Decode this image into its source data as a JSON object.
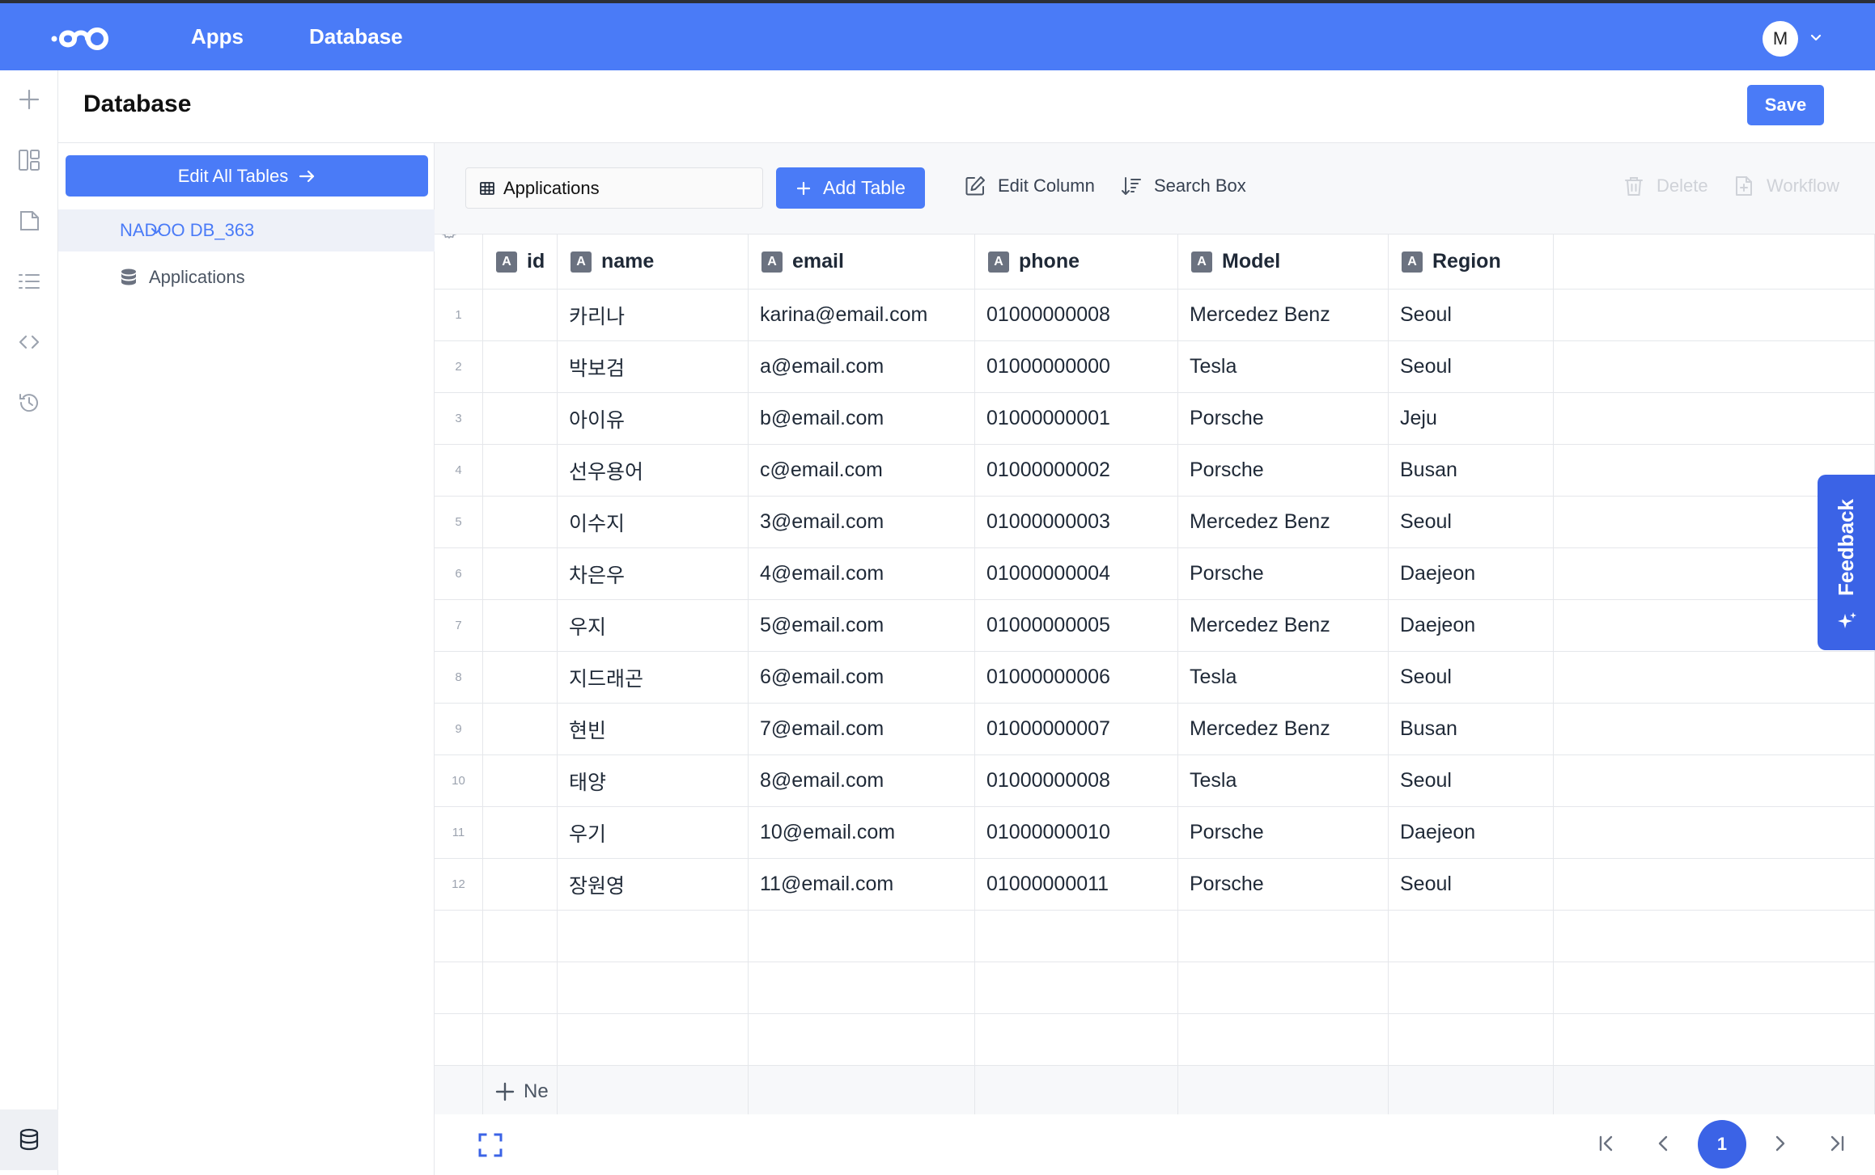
{
  "topbar": {
    "nav": [
      "Apps",
      "Database"
    ],
    "avatar_initial": "M"
  },
  "page": {
    "title": "Database",
    "save_label": "Save"
  },
  "sidebar": {
    "edit_all_label": "Edit All Tables",
    "database_name": "NADOO DB_363",
    "tables": [
      "Applications"
    ]
  },
  "toolbar": {
    "selected_table": "Applications",
    "add_table_label": "Add Table",
    "edit_column_label": "Edit Column",
    "search_box_label": "Search Box",
    "delete_label": "Delete",
    "workflow_label": "Workflow"
  },
  "table": {
    "columns": [
      "id",
      "name",
      "email",
      "phone",
      "Model",
      "Region"
    ],
    "rows": [
      [
        "1",
        "",
        "카리나",
        "karina@email.com",
        "01000000008",
        "Mercedez Benz",
        "Seoul"
      ],
      [
        "2",
        "",
        "박보검",
        "a@email.com",
        "01000000000",
        "Tesla",
        "Seoul"
      ],
      [
        "3",
        "",
        "아이유",
        "b@email.com",
        "01000000001",
        "Porsche",
        "Jeju"
      ],
      [
        "4",
        "",
        "선우용어",
        "c@email.com",
        "01000000002",
        "Porsche",
        "Busan"
      ],
      [
        "5",
        "",
        "이수지",
        "3@email.com",
        "01000000003",
        "Mercedez Benz",
        "Seoul"
      ],
      [
        "6",
        "",
        "차은우",
        "4@email.com",
        "01000000004",
        "Porsche",
        "Daejeon"
      ],
      [
        "7",
        "",
        "우지",
        "5@email.com",
        "01000000005",
        "Mercedez Benz",
        "Daejeon"
      ],
      [
        "8",
        "",
        "지드래곤",
        "6@email.com",
        "01000000006",
        "Tesla",
        "Seoul"
      ],
      [
        "9",
        "",
        "현빈",
        "7@email.com",
        "01000000007",
        "Mercedez Benz",
        "Busan"
      ],
      [
        "10",
        "",
        "태양",
        "8@email.com",
        "01000000008",
        "Tesla",
        "Seoul"
      ],
      [
        "11",
        "",
        "우기",
        "10@email.com",
        "01000000010",
        "Porsche",
        "Daejeon"
      ],
      [
        "12",
        "",
        "장원영",
        "11@email.com",
        "01000000011",
        "Porsche",
        "Seoul"
      ]
    ],
    "new_row_label": "Ne"
  },
  "pagination": {
    "current_page": "1"
  },
  "feedback_label": "Feedback",
  "accent_color": "#4a7bf7"
}
